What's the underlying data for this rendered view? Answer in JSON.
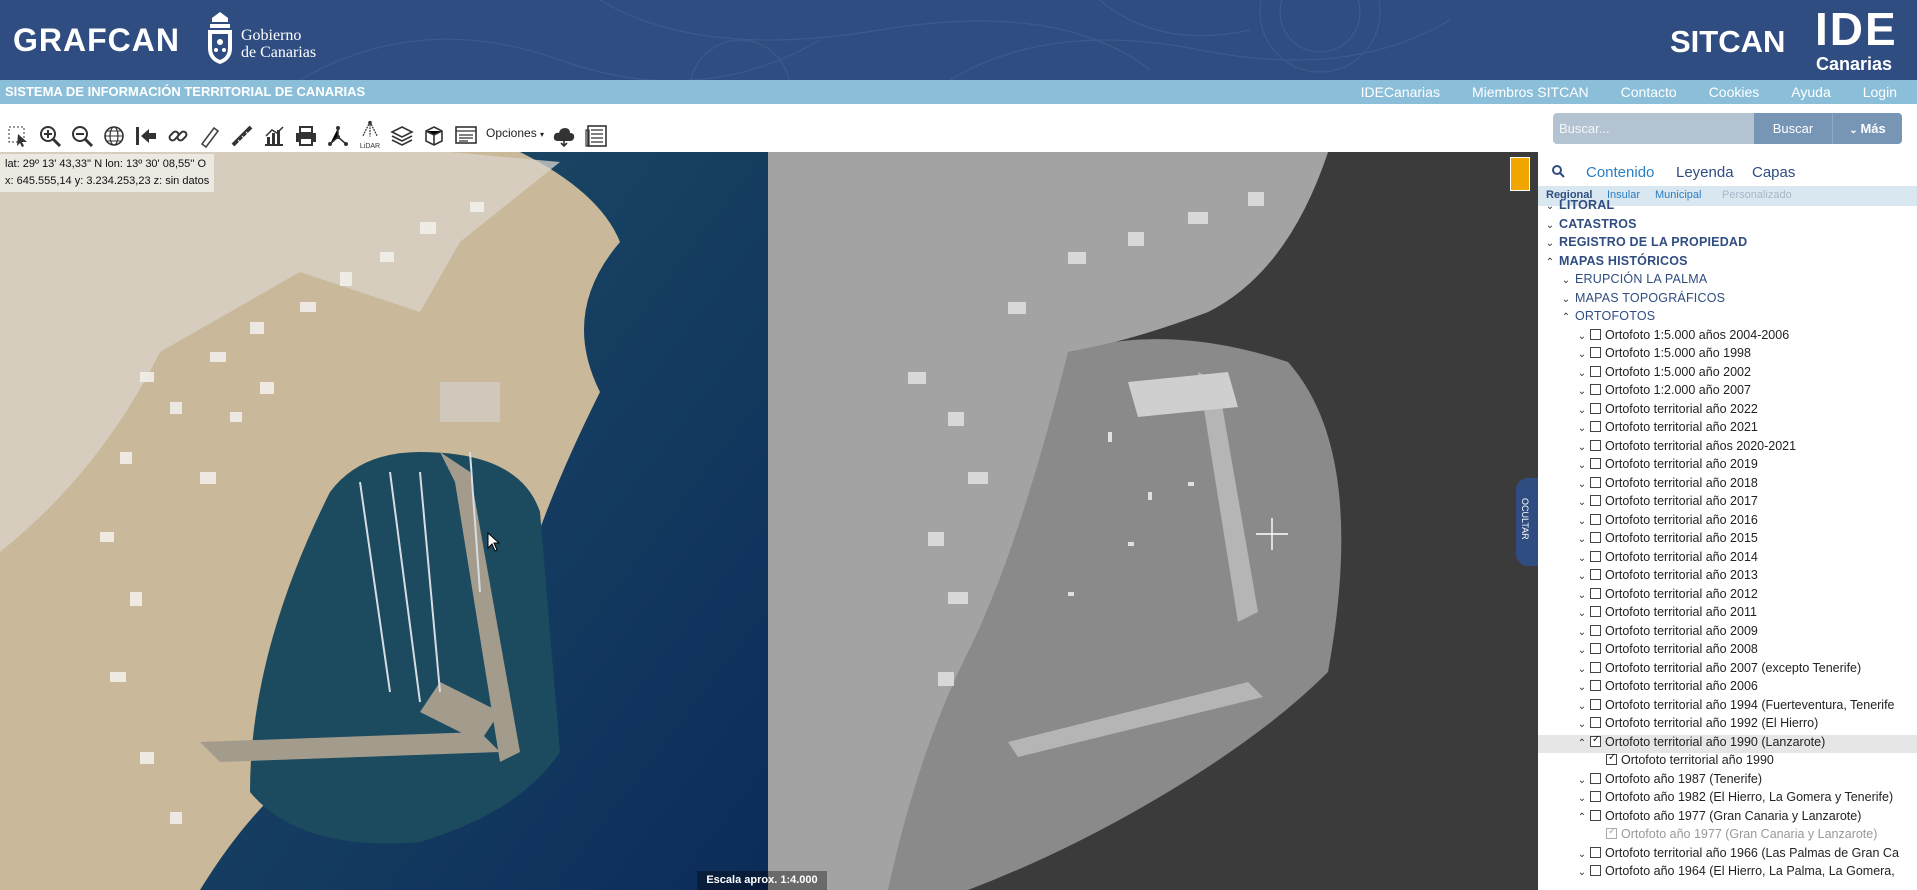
{
  "header": {
    "brand": "GRAFCAN",
    "gov_line1": "Gobierno",
    "gov_line2": "de Canarias",
    "sitcan": "SITCAN",
    "ide": "IDE",
    "ide_sub": "Canarias"
  },
  "navbar": {
    "title": "SISTEMA DE INFORMACIÓN TERRITORIAL DE CANARIAS",
    "links": [
      "IDECanarias",
      "Miembros SITCAN",
      "Contacto",
      "Cookies",
      "Ayuda",
      "Login"
    ]
  },
  "toolbar": {
    "options_label": "Opciones",
    "lidar_label": "LiDAR"
  },
  "search": {
    "placeholder": "Buscar...",
    "button": "Buscar",
    "more": "Más"
  },
  "map": {
    "coords_line1": "lat: 29º 13' 43,33'' N  lon: 13º 30' 08,55'' O",
    "coords_line2": "x: 645.555,14  y: 3.234.253,23  z: sin datos",
    "scale": "Escala aprox. 1:4.000",
    "hide_label": "OCULTAR"
  },
  "sidebar": {
    "tabs": [
      "Contenido",
      "Leyenda",
      "Capas"
    ],
    "subtabs": [
      "Regional",
      "Insular",
      "Municipal",
      "Personalizado"
    ],
    "tree": [
      {
        "label": "LITORAL",
        "level": 0,
        "chev": "v",
        "style": "caps"
      },
      {
        "label": "CATASTROS",
        "level": 0,
        "chev": "v",
        "style": "caps"
      },
      {
        "label": "REGISTRO DE LA PROPIEDAD",
        "level": 0,
        "chev": "v",
        "style": "caps"
      },
      {
        "label": "MAPAS HISTÓRICOS",
        "level": 0,
        "chev": "^",
        "style": "caps"
      },
      {
        "label": "ERUPCIÓN LA PALMA",
        "level": 1,
        "chev": "v",
        "style": "caps2"
      },
      {
        "label": "MAPAS TOPOGRÁFICOS",
        "level": 1,
        "chev": "v",
        "style": "caps2"
      },
      {
        "label": "ORTOFOTOS",
        "level": 1,
        "chev": "^",
        "style": "caps2"
      },
      {
        "label": "Ortofoto 1:5.000 años 2004-2006",
        "level": 2,
        "chev": "v",
        "cb": false
      },
      {
        "label": "Ortofoto 1:5.000 año 1998",
        "level": 2,
        "chev": "v",
        "cb": false
      },
      {
        "label": "Ortofoto 1:5.000 año 2002",
        "level": 2,
        "chev": "v",
        "cb": false
      },
      {
        "label": "Ortofoto 1:2.000 año 2007",
        "level": 2,
        "chev": "v",
        "cb": false
      },
      {
        "label": "Ortofoto territorial año 2022",
        "level": 2,
        "chev": "v",
        "cb": false
      },
      {
        "label": "Ortofoto territorial año 2021",
        "level": 2,
        "chev": "v",
        "cb": false
      },
      {
        "label": "Ortofoto territorial años 2020-2021",
        "level": 2,
        "chev": "v",
        "cb": false
      },
      {
        "label": "Ortofoto territorial año 2019",
        "level": 2,
        "chev": "v",
        "cb": false
      },
      {
        "label": "Ortofoto territorial año 2018",
        "level": 2,
        "chev": "v",
        "cb": false
      },
      {
        "label": "Ortofoto territorial año 2017",
        "level": 2,
        "chev": "v",
        "cb": false
      },
      {
        "label": "Ortofoto territorial año 2016",
        "level": 2,
        "chev": "v",
        "cb": false
      },
      {
        "label": "Ortofoto territorial año 2015",
        "level": 2,
        "chev": "v",
        "cb": false
      },
      {
        "label": "Ortofoto territorial año 2014",
        "level": 2,
        "chev": "v",
        "cb": false
      },
      {
        "label": "Ortofoto territorial año 2013",
        "level": 2,
        "chev": "v",
        "cb": false
      },
      {
        "label": "Ortofoto territorial año 2012",
        "level": 2,
        "chev": "v",
        "cb": false
      },
      {
        "label": "Ortofoto territorial año 2011",
        "level": 2,
        "chev": "v",
        "cb": false
      },
      {
        "label": "Ortofoto territorial año 2009",
        "level": 2,
        "chev": "v",
        "cb": false
      },
      {
        "label": "Ortofoto territorial año 2008",
        "level": 2,
        "chev": "v",
        "cb": false
      },
      {
        "label": "Ortofoto territorial año 2007 (excepto Tenerife)",
        "level": 2,
        "chev": "v",
        "cb": false
      },
      {
        "label": "Ortofoto territorial año 2006",
        "level": 2,
        "chev": "v",
        "cb": false
      },
      {
        "label": "Ortofoto territorial año 1994 (Fuerteventura, Tenerife",
        "level": 2,
        "chev": "v",
        "cb": false
      },
      {
        "label": "Ortofoto territorial año 1992 (El Hierro)",
        "level": 2,
        "chev": "v",
        "cb": false
      },
      {
        "label": "Ortofoto territorial año 1990 (Lanzarote)",
        "level": 2,
        "chev": "^",
        "cb": true,
        "selected": true
      },
      {
        "label": "Ortofoto territorial año 1990",
        "level": 3,
        "chev": "",
        "cb": true
      },
      {
        "label": "Ortofoto año 1987 (Tenerife)",
        "level": 2,
        "chev": "v",
        "cb": false
      },
      {
        "label": "Ortofoto año 1982 (El Hierro, La Gomera y Tenerife)",
        "level": 2,
        "chev": "v",
        "cb": false
      },
      {
        "label": "Ortofoto año 1977 (Gran Canaria y Lanzarote)",
        "level": 2,
        "chev": "^",
        "cb": false
      },
      {
        "label": "Ortofoto año 1977 (Gran Canaria y Lanzarote)",
        "level": 3,
        "chev": "",
        "cb": true,
        "grey": true
      },
      {
        "label": "Ortofoto territorial año 1966 (Las Palmas de Gran Ca",
        "level": 2,
        "chev": "v",
        "cb": false
      },
      {
        "label": "Ortofoto año 1964 (El Hierro, La Palma, La Gomera,",
        "level": 2,
        "chev": "v",
        "cb": false
      }
    ]
  }
}
